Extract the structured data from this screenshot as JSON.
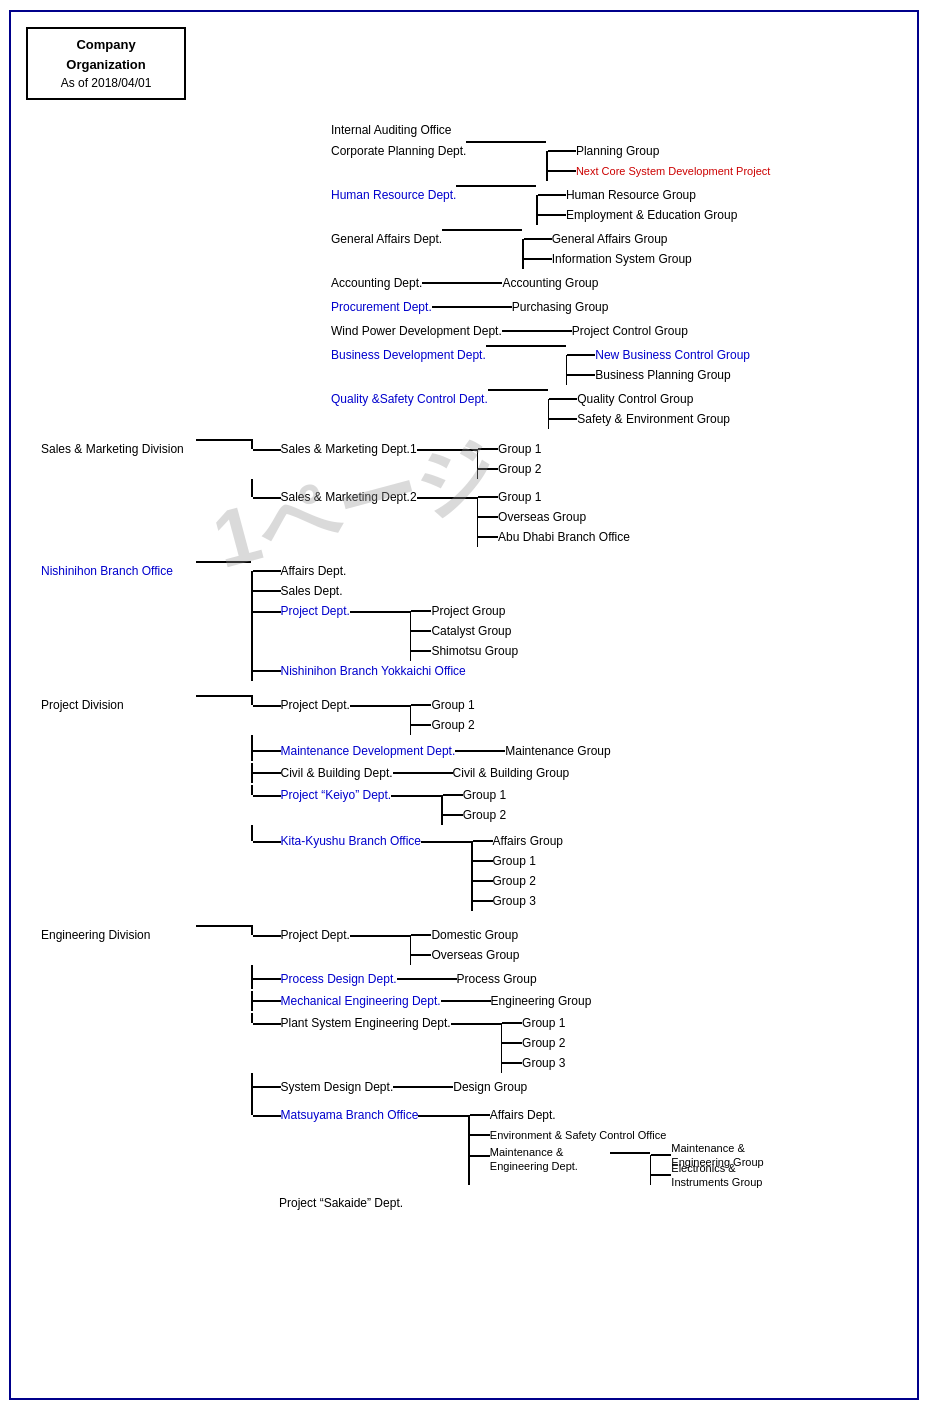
{
  "header": {
    "title_line1": "Company",
    "title_line2": "Organization",
    "date": "As of 2018/04/01"
  },
  "watermark": "1ページ",
  "nodes": {
    "internal_auditing": "Internal Auditing Office",
    "corporate_planning": "Corporate Planning Dept.",
    "planning_group": "Planning Group",
    "next_core": "Next Core System Development Project",
    "human_resource_dept": "Human Resource Dept.",
    "human_resource_group": "Human Resource Group",
    "employment_education": "Employment & Education Group",
    "general_affairs_dept": "General Affairs Dept.",
    "general_affairs_group": "General Affairs Group",
    "info_system": "Information System Group",
    "accounting_dept": "Accounting Dept.",
    "accounting_group": "Accounting Group",
    "procurement_dept": "Procurement Dept.",
    "purchasing_group": "Purchasing Group",
    "wind_power_dept": "Wind Power Development Dept.",
    "project_control": "Project Control Group",
    "business_dev_dept": "Business Development Dept.",
    "new_business_control": "New Business Control Group",
    "business_planning": "Business Planning Group",
    "quality_safety_dept": "Quality &Safety Control Dept.",
    "quality_control": "Quality Control Group",
    "safety_environment": "Safety & Environment Group",
    "sales_marketing_div": "Sales & Marketing Division",
    "sales_marketing_dept1": "Sales & Marketing Dept.1",
    "sm_group1": "Group 1",
    "sm_group2": "Group 2",
    "sales_marketing_dept2": "Sales & Marketing Dept.2",
    "sm2_group1": "Group 1",
    "overseas_group": "Overseas Group",
    "abu_dhabi": "Abu Dhabi Branch Office",
    "nishinihon_branch": "Nishinihon Branch Office",
    "affairs_dept": "Affairs Dept.",
    "sales_dept": "Sales Dept.",
    "project_dept_ni": "Project Dept.",
    "project_group_ni": "Project Group",
    "catalyst_group": "Catalyst Group",
    "shimotsu_group": "Shimotsu Group",
    "yokkaichi": "Nishinihon Branch Yokkaichi Office",
    "project_division": "Project Division",
    "project_dept_pd": "Project Dept.",
    "pd_group1": "Group 1",
    "pd_group2": "Group 2",
    "maintenance_dev_dept": "Maintenance Development Dept.",
    "maintenance_group": "Maintenance Group",
    "civil_building_dept": "Civil & Building Dept.",
    "civil_building_group": "Civil & Building Group",
    "project_keiyo_dept": "Project “Keiyo” Dept.",
    "pk_group1": "Group 1",
    "pk_group2": "Group 2",
    "kita_kyushu": "Kita-Kyushu Branch Office",
    "kk_affairs": "Affairs Group",
    "kk_group1": "Group 1",
    "kk_group2": "Group 2",
    "kk_group3": "Group 3",
    "engineering_division": "Engineering Division",
    "project_dept_ed": "Project Dept.",
    "domestic_group": "Domestic Group",
    "ed_overseas": "Overseas Group",
    "process_design_dept": "Process Design Dept.",
    "process_group": "Process Group",
    "mechanical_eng_dept": "Mechanical Engineering Dept.",
    "engineering_group": "Engineering Group",
    "plant_system_dept": "Plant System Engineering Dept.",
    "ps_group1": "Group 1",
    "ps_group2": "Group 2",
    "ps_group3": "Group 3",
    "system_design_dept": "System Design Dept.",
    "design_group": "Design Group",
    "matsuyama_branch": "Matsuyama Branch Office",
    "mb_affairs_dept": "Affairs Dept.",
    "env_safety_office": "Environment & Safety Control Office",
    "maintenance_eng_dept": "Maintenance &\nEngineering Dept.",
    "maintenance_eng_group": "Maintenance &\nEngineering Group",
    "electronics_instruments": "Electronics &\nInstruments Group",
    "project_sakaide": "Project “Sakaide” Dept."
  }
}
